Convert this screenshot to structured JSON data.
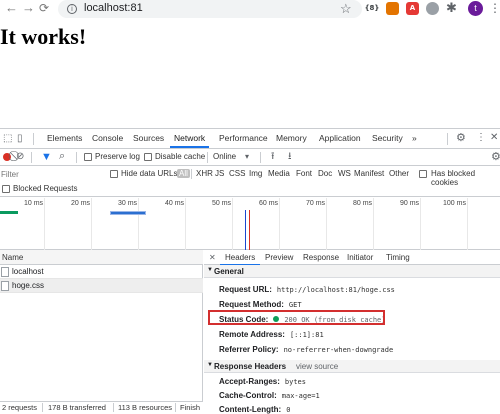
{
  "browser": {
    "url": "localhost:81",
    "extensions": [
      {
        "name": "ext-codes",
        "label": "{8}",
        "color": "#3c4043"
      },
      {
        "name": "ext-orange",
        "label": "",
        "color": "#e37400"
      },
      {
        "name": "ext-acrobat",
        "label": "A",
        "color": "#e53935"
      },
      {
        "name": "ext-grey",
        "label": "",
        "color": "#9aa0a6"
      }
    ],
    "avatar_letter": "t"
  },
  "page": {
    "heading": "It works!"
  },
  "devtools": {
    "tabs": [
      "Elements",
      "Console",
      "Sources",
      "Network",
      "Performance",
      "Memory",
      "Application",
      "Security"
    ],
    "active_tab": "Network",
    "more_tabs": "»",
    "toolbar": {
      "preserve_log": "Preserve log",
      "disable_cache": "Disable cache",
      "throttling": "Online"
    },
    "filter": {
      "placeholder": "Filter",
      "hide_data_urls": "Hide data URLs",
      "types": [
        "All",
        "XHR",
        "JS",
        "CSS",
        "Img",
        "Media",
        "Font",
        "Doc",
        "WS",
        "Manifest",
        "Other"
      ],
      "has_blocked_cookies": "Has blocked cookies",
      "blocked_requests": "Blocked Requests"
    },
    "timeline": {
      "ticks": [
        "10 ms",
        "20 ms",
        "30 ms",
        "40 ms",
        "50 ms",
        "60 ms",
        "70 ms",
        "80 ms",
        "90 ms",
        "100 ms"
      ]
    },
    "requests": {
      "column_name": "Name",
      "rows": [
        "localhost",
        "hoge.css"
      ]
    },
    "details": {
      "tabs": [
        "Headers",
        "Preview",
        "Response",
        "Initiator",
        "Timing"
      ],
      "active_tab": "Headers",
      "general_title": "General",
      "general": [
        {
          "key": "Request URL:",
          "value": "http://localhost:81/hoge.css"
        },
        {
          "key": "Request Method:",
          "value": "GET"
        },
        {
          "key": "Status Code:",
          "value": "200 OK (from disk cache)"
        },
        {
          "key": "Remote Address:",
          "value": "[::1]:81"
        },
        {
          "key": "Referrer Policy:",
          "value": "no-referrer-when-downgrade"
        }
      ],
      "response_headers_title": "Response Headers",
      "view_source": "view source",
      "response_headers": [
        {
          "key": "Accept-Ranges:",
          "value": "bytes"
        },
        {
          "key": "Cache-Control:",
          "value": "max-age=1"
        },
        {
          "key": "Content-Length:",
          "value": "0"
        }
      ]
    },
    "summary": [
      "2 requests",
      "178 B transferred",
      "113 B resources",
      "Finish"
    ]
  },
  "colors": {
    "accent": "#1a73e8",
    "record": "#d93025",
    "highlight": "#d32f2f",
    "status_ok": "#0f9d58"
  }
}
